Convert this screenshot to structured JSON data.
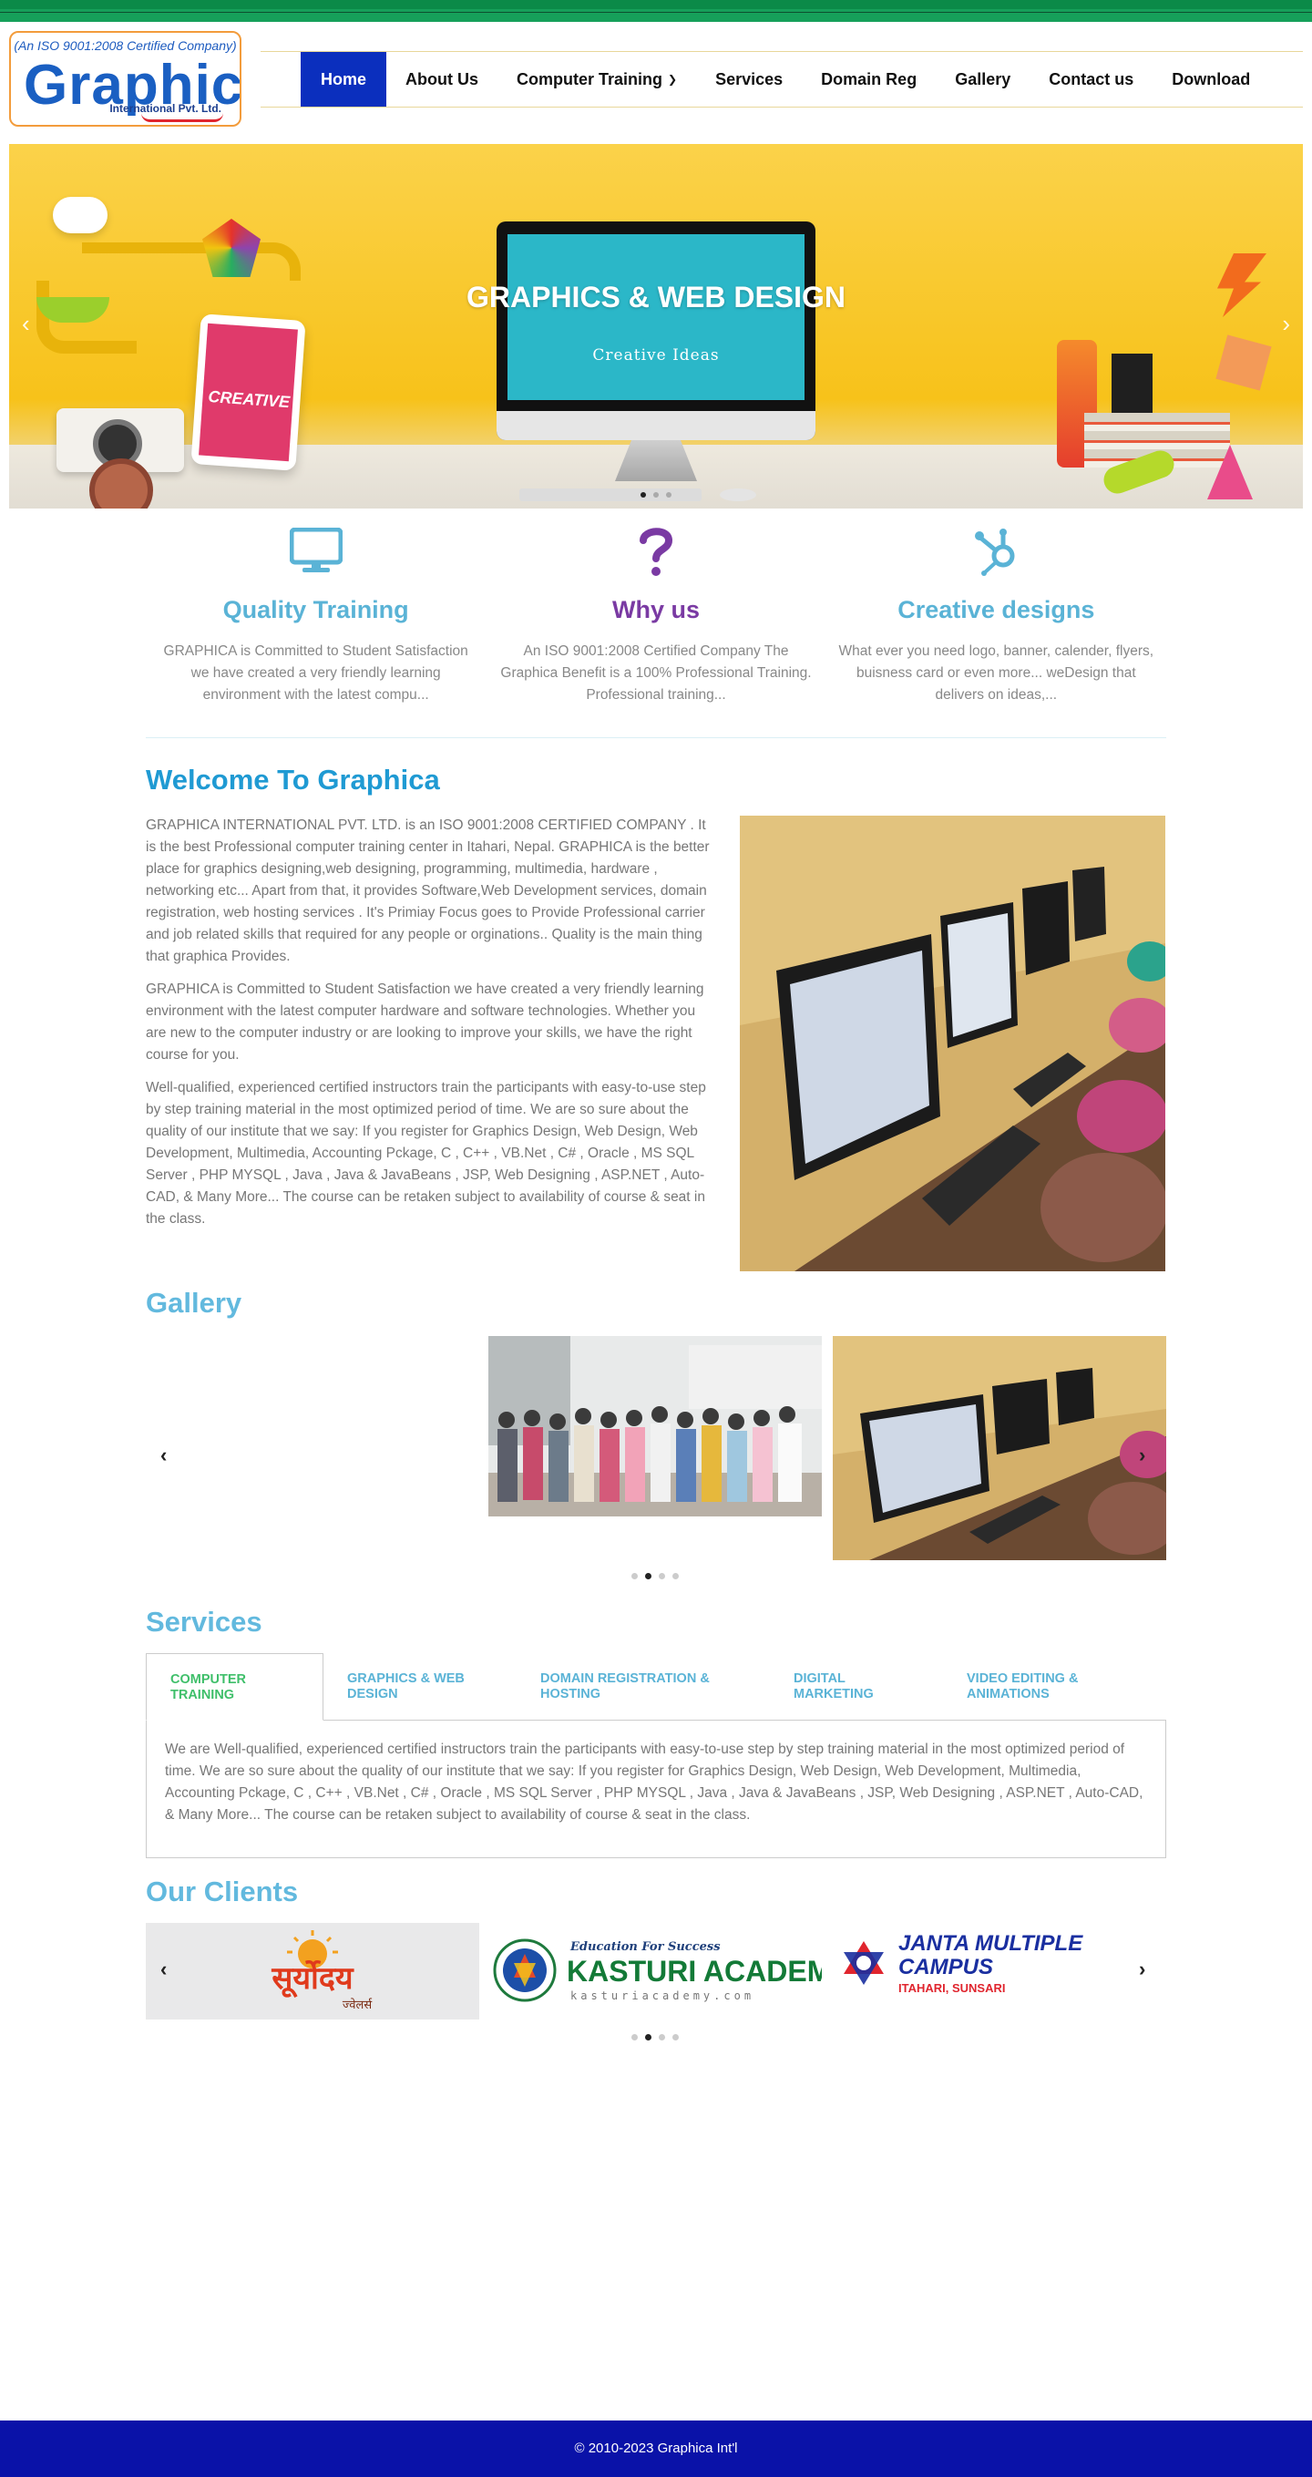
{
  "logo": {
    "cert": "(An ISO 9001:2008 Certified Company)",
    "name": "Graphica",
    "sub": "International Pvt. Ltd."
  },
  "nav": {
    "items": [
      {
        "label": "Home",
        "active": true
      },
      {
        "label": "About Us"
      },
      {
        "label": "Computer Training",
        "has_dropdown": true
      },
      {
        "label": "Services"
      },
      {
        "label": "Domain Reg"
      },
      {
        "label": "Gallery"
      },
      {
        "label": "Contact us"
      },
      {
        "label": "Download"
      }
    ]
  },
  "hero": {
    "title": "GRAPHICS & WEB DESIGN",
    "subtitle": "Creative Ideas",
    "tablet_text": "CREATIVE",
    "slides": 3,
    "active_slide": 1
  },
  "features": [
    {
      "icon": "monitor-icon",
      "title": "Quality Training",
      "color": "#5ab3d6",
      "text": "GRAPHICA is Committed to Student Satisfaction we have created a very friendly learning environment with the latest compu..."
    },
    {
      "icon": "question-icon",
      "title": "Why us",
      "color": "#7a3aa3",
      "text": "An ISO 9001:2008 Certified Company The Graphica Benefit is a 100% Professional Training. Professional training..."
    },
    {
      "icon": "hubspot-icon",
      "title": "Creative designs",
      "color": "#5ab3d6",
      "text": "What ever you need logo, banner, calender, flyers, buisness card or even more... weDesign that delivers on ideas,..."
    }
  ],
  "welcome": {
    "heading": "Welcome To Graphica",
    "p1": "GRAPHICA INTERNATIONAL PVT. LTD. is an ISO 9001:2008 CERTIFIED COMPANY . It is the best Professional  computer training center in Itahari, Nepal.  GRAPHICA is the better place for graphics designing,web designing, programming, multimedia, hardware , networking etc... Apart from that, it provides Software,Web Development services, domain registration, web hosting services . It's Primiay Focus goes to Provide Professional carrier and job related skills that required for any people or orginations.. Quality is the main thing that graphica Provides.",
    "p2": "GRAPHICA is Committed to Student Satisfaction we have created a very friendly learning environment with the latest computer hardware and software technologies. Whether you are new to the computer industry or are looking to improve your skills, we have the right course for you.",
    "p3": "Well-qualified, experienced certified instructors train the participants with easy-to-use step by step training material in the most optimized period of time. We are so sure about the quality of our institute that we say: If you register for Graphics Design, Web Design, Web Development, Multimedia, Accounting Pckage, C , C++ , VB.Net , C# , Oracle , MS SQL Server , PHP MYSQL , Java , Java & JavaBeans , JSP, Web Designing , ASP.NET , Auto-CAD, & Many More... The course can be retaken subject to availability of course & seat in the class."
  },
  "gallery": {
    "heading": "Gallery",
    "dots": 4,
    "active_dot": 2
  },
  "services": {
    "heading": "Services",
    "tabs": [
      {
        "label": "COMPUTER TRAINING",
        "active": true
      },
      {
        "label": "GRAPHICS & WEB DESIGN"
      },
      {
        "label": "DOMAIN REGISTRATION & HOSTING"
      },
      {
        "label": "DIGITAL MARKETING"
      },
      {
        "label": "VIDEO EDITING & ANIMATIONS"
      }
    ],
    "body": "We are Well-qualified, experienced certified instructors train the participants with easy-to-use step by step training material in the most optimized period of time. We are so sure about the quality of our institute that we say: If you register for Graphics Design, Web Design, Web Development, Multimedia, Accounting Pckage, C , C++ , VB.Net , C# , Oracle , MS SQL Server , PHP MYSQL , Java , Java & JavaBeans , JSP, Web Designing , ASP.NET , Auto-CAD, & Many More... The course can be retaken subject to availability of course & seat in the class."
  },
  "clients": {
    "heading": "Our Clients",
    "logos": [
      {
        "name": "सूर्योदय",
        "sub": "ज्वेलर्स"
      },
      {
        "tagline": "Education For Success",
        "name": "KASTURI ACADEMY",
        "url": "kasturiacademy.com"
      },
      {
        "name": "JANTA MULTIPLE CAMPUS",
        "sub": "ITAHARI, SUNSARI"
      }
    ],
    "dots": 4,
    "active_dot": 2
  },
  "footer": {
    "text": "© 2010-2023  Graphica Int'l"
  },
  "colors": {
    "nav_active": "#0b2fbe",
    "accent_blue": "#5ab3d6",
    "heading_blue": "#1f9ad3",
    "purple": "#7a3aa3",
    "tab_active": "#3fbf6a",
    "footer": "#0a12a8",
    "topbar": "#16a05a"
  }
}
